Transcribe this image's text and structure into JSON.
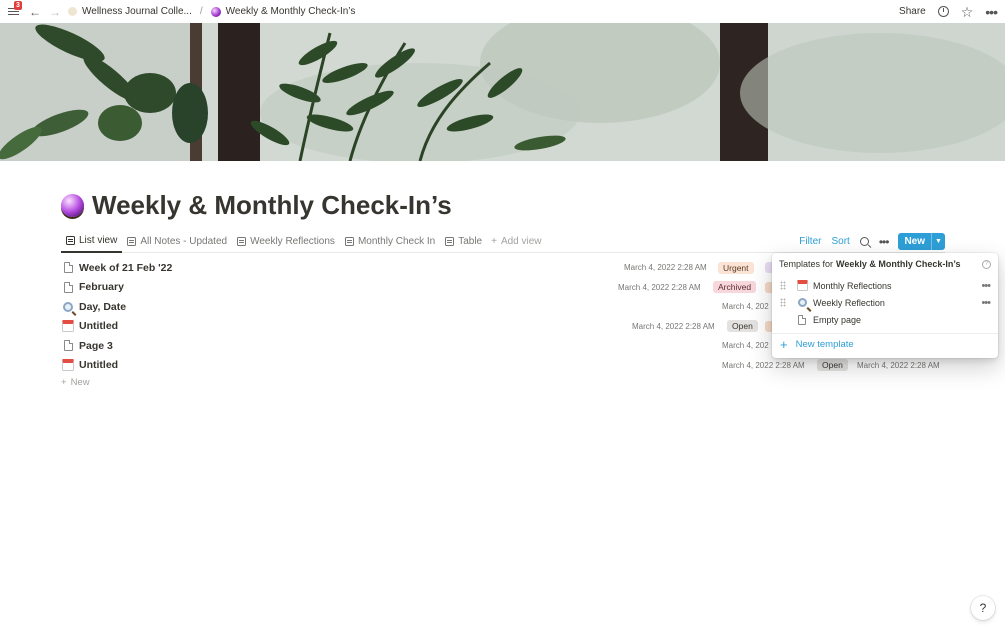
{
  "topbar": {
    "notification_count": "3",
    "breadcrumbs": [
      "Wellness Journal Colle...",
      "Weekly & Monthly Check-In’s"
    ],
    "separator": "/",
    "share_label": "Share"
  },
  "page": {
    "title": "Weekly & Monthly Check-In’s"
  },
  "views": {
    "tabs": [
      {
        "label": "List view",
        "active": true
      },
      {
        "label": "All Notes - Updated"
      },
      {
        "label": "Weekly Reflections"
      },
      {
        "label": "Monthly Check In"
      },
      {
        "label": "Table"
      }
    ],
    "add_view_label": "Add view",
    "filter_label": "Filter",
    "sort_label": "Sort",
    "new_label": "New"
  },
  "rows": [
    {
      "icon": "page-icon",
      "title": "Week of 21 Feb '22",
      "date": "March 4, 2022 2:28 AM",
      "tag": "Urgent"
    },
    {
      "icon": "page-icon",
      "title": "February",
      "date": "March 4, 2022 2:28 AM",
      "tag": "Archived"
    },
    {
      "icon": "magnifier-icon",
      "title": "Day, Date",
      "date": "March 4, 202",
      "tag": ""
    },
    {
      "icon": "calendar-icon",
      "title": "Untitled",
      "date": "March 4, 2022 2:28 AM",
      "tag": "Open"
    },
    {
      "icon": "page-icon",
      "title": "Page 3",
      "date": "March 4, 202",
      "tag": ""
    },
    {
      "icon": "calendar-icon",
      "title": "Untitled",
      "date": "March 4, 2022 2:28 AM",
      "tag": "Open",
      "date2": "March 4, 2022 2:28 AM"
    }
  ],
  "add_new_label": "New",
  "templates_popup": {
    "heading_prefix": "Templates for",
    "heading_db": "Weekly & Monthly Check-In’s",
    "items": [
      {
        "icon": "calendar-icon",
        "label": "Monthly Reflections"
      },
      {
        "icon": "magnifier-icon",
        "label": "Weekly Reflection"
      },
      {
        "icon": "page-icon",
        "label": "Empty page"
      }
    ],
    "new_template_label": "New template"
  },
  "help_label": "?",
  "colors": {
    "accent": "#2e9fd6",
    "tag_urgent": "#fbe4d5",
    "tag_archived": "#f7d7dc",
    "tag_open": "#e3e2e0"
  }
}
